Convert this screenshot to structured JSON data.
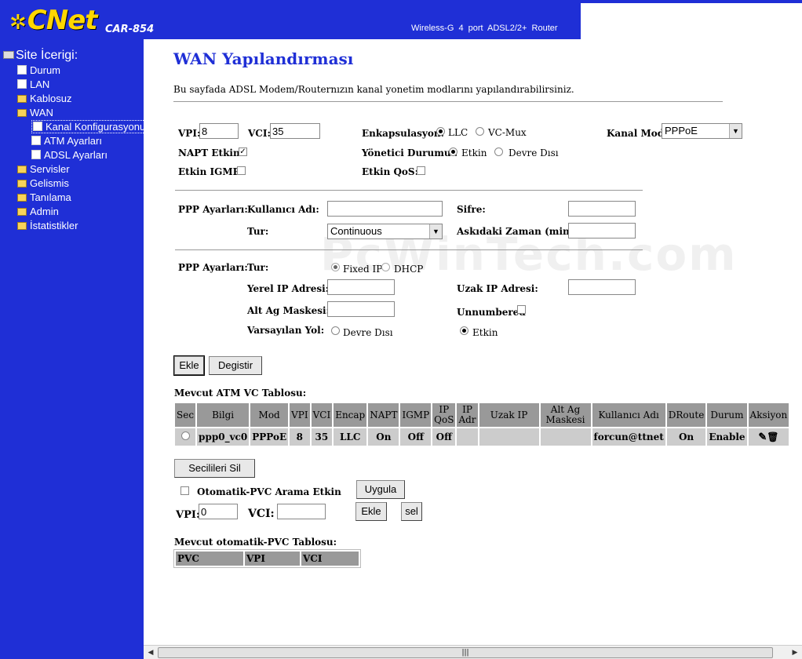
{
  "header": {
    "logo_text": "CNet",
    "model": "CAR-854",
    "tagline": "Wireless-G 4 port ADSL2/2+ Router"
  },
  "sidebar": {
    "root_label": "Site İcerigi:",
    "items": [
      {
        "label": "Durum",
        "icon": "page-icon"
      },
      {
        "label": "LAN",
        "icon": "page-icon"
      },
      {
        "label": "Kablosuz",
        "icon": "folder-icon"
      },
      {
        "label": "WAN",
        "icon": "folder-open-icon"
      },
      {
        "label": "Kanal Konfigurasyonu",
        "icon": "page-icon"
      },
      {
        "label": "ATM Ayarları",
        "icon": "page-icon"
      },
      {
        "label": "ADSL Ayarları",
        "icon": "page-icon"
      },
      {
        "label": "Servisler",
        "icon": "folder-icon"
      },
      {
        "label": "Gelismis",
        "icon": "folder-icon"
      },
      {
        "label": "Tanılama",
        "icon": "folder-icon"
      },
      {
        "label": "Admin",
        "icon": "folder-icon"
      },
      {
        "label": "İstatistikler",
        "icon": "folder-icon"
      }
    ]
  },
  "main": {
    "title": "WAN Yapılandırması",
    "description": "Bu sayfada ADSL Modem/Routernızın kanal yonetim modlarını yapılandırabilirsiniz.",
    "watermark": "PcWinTech.com",
    "vpi_label": "VPI:",
    "vpi_value": "8",
    "vci_label": "VCI:",
    "vci_value": "35",
    "encap_label": "Enkapsulasyon:",
    "encap_llc": "LLC",
    "encap_vcmux": "VC-Mux",
    "channel_mode_label": "Kanal Modu:",
    "channel_mode_value": "PPPoE",
    "napt_label": "NAPT Etkin:",
    "admin_status_label": "Yönetici Durumu :",
    "admin_enabled": "Etkin",
    "admin_disabled": "Devre Dısı",
    "igmp_label": "Etkin IGMP:",
    "qos_label": "Etkin QoS:",
    "ppp1_label": "PPP Ayarları:",
    "username_label": "Kullanıcı Adı:",
    "password_label": "Sifre:",
    "type_label": "Tur:",
    "type_value": "Continuous",
    "idle_label": "Askıdaki Zaman (min):",
    "ppp2_label": "PPP Ayarları:",
    "ip_type_label": "Tur:",
    "fixed_ip": "Fixed IP",
    "dhcp": "DHCP",
    "local_ip_label": "Yerel IP Adresi:",
    "remote_ip_label": "Uzak IP Adresi:",
    "subnet_label": "Alt Ag Maskesi:",
    "unnumbered_label": "Unnumbered",
    "default_route_label": "Varsayılan Yol:",
    "default_route_disabled": "Devre Dısı",
    "default_route_enabled": "Etkin",
    "add_button": "Ekle",
    "modify_button": "Degistir",
    "atm_table_title": "Mevcut ATM VC Tablosu:",
    "atm_headers": [
      "Sec",
      "Bilgi",
      "Mod",
      "VPI",
      "VCI",
      "Encap",
      "NAPT",
      "IGMP",
      "IP QoS",
      "IP Adr",
      "Uzak IP",
      "Alt Ag Maskesi",
      "Kullanıcı Adı",
      "DRoute",
      "Durum",
      "Aksiyon"
    ],
    "atm_rows": [
      {
        "bilgi": "ppp0_vc0",
        "mod": "PPPoE",
        "vpi": "8",
        "vci": "35",
        "encap": "LLC",
        "napt": "On",
        "igmp": "Off",
        "qos": "Off",
        "ipadr": "",
        "remote": "",
        "mask": "",
        "user": "forcun@ttnet",
        "droute": "On",
        "status": "Enable"
      }
    ],
    "delete_selected_button": "Secilileri Sil",
    "auto_pvc_label": "Otomatik-PVC Arama Etkin",
    "apply_button": "Uygula",
    "auto_vpi_label": "VPI:",
    "auto_vpi_value": "0",
    "auto_vci_label": "VCI:",
    "auto_vci_value": "",
    "auto_add_button": "Ekle",
    "auto_sel_button": "sel",
    "auto_table_title": "Mevcut otomatik-PVC Tablosu:",
    "auto_headers": [
      "PVC",
      "VPI",
      "VCI"
    ]
  }
}
